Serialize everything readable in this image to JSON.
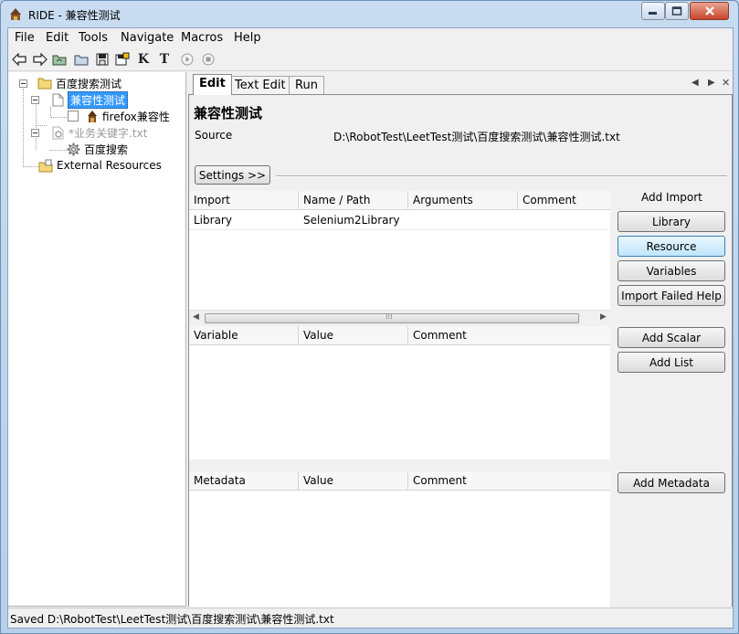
{
  "window": {
    "title": "RIDE - 兼容性测试",
    "controls": {
      "minimize": "—",
      "maximize": "□",
      "close": "✕"
    }
  },
  "menu": [
    "File",
    "Edit",
    "Tools",
    "Navigate",
    "Macros",
    "Help"
  ],
  "toolbar": {
    "icons": [
      "back-arrow-icon",
      "forward-arrow-icon",
      "open-suite-icon",
      "open-folder-icon",
      "save-icon",
      "save-all-icon",
      "keyword-search-icon",
      "text-search-icon",
      "run-icon",
      "stop-icon"
    ],
    "k_label": "K",
    "t_label": "T"
  },
  "tree": {
    "root": "百度搜索测试",
    "selected_suite": "兼容性测试",
    "test_case": "firefox兼容性",
    "resource_file": "*业务关键字.txt",
    "keyword": "百度搜索",
    "external": "External Resources"
  },
  "tabs": [
    "Edit",
    "Text Edit",
    "Run"
  ],
  "tab_nav": {
    "prev": "◀",
    "next": "▶",
    "close": "✕"
  },
  "editor": {
    "suite_title": "兼容性测试",
    "source_label": "Source",
    "source_path": "D:\\RobotTest\\LeetTest测试\\百度搜索测试\\兼容性测试.txt",
    "settings_button": "Settings >>"
  },
  "imports": {
    "columns": [
      "Import",
      "Name / Path",
      "Arguments",
      "Comment"
    ],
    "rows": [
      [
        "Library",
        "Selenium2Library",
        "",
        ""
      ]
    ],
    "scroll_grip": "⁞⁞⁞",
    "scroll_left": "◀",
    "scroll_right": "▶"
  },
  "import_actions": {
    "label": "Add Import",
    "buttons": [
      "Library",
      "Resource",
      "Variables",
      "Import Failed Help"
    ]
  },
  "variables": {
    "columns": [
      "Variable",
      "Value",
      "Comment"
    ]
  },
  "variable_actions": [
    "Add Scalar",
    "Add List"
  ],
  "metadata": {
    "columns": [
      "Metadata",
      "Value",
      "Comment"
    ]
  },
  "metadata_actions": [
    "Add Metadata"
  ],
  "status": "Saved D:\\RobotTest\\LeetTest测试\\百度搜索测试\\兼容性测试.txt"
}
